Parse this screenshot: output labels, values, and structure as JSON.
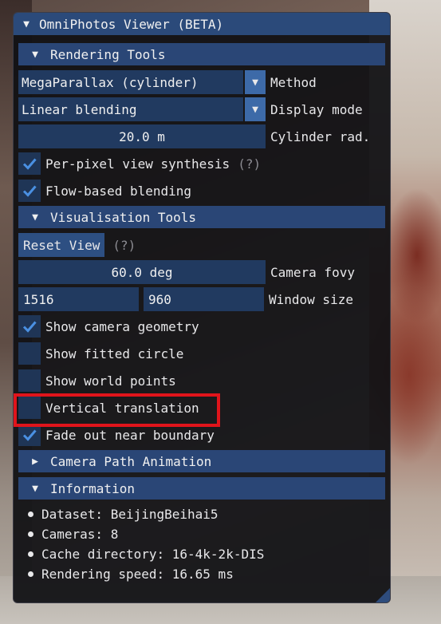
{
  "window": {
    "title": "OmniPhotos Viewer (BETA)"
  },
  "rendering": {
    "header": "Rendering Tools",
    "method": {
      "value": "MegaParallax (cylinder)",
      "label": "Method"
    },
    "display_mode": {
      "value": "Linear blending",
      "label": "Display mode"
    },
    "cylinder_radius": {
      "value": "20.0 m",
      "label": "Cylinder rad."
    },
    "per_pixel": {
      "label": "Per-pixel view synthesis",
      "checked": true,
      "hint": "(?)"
    },
    "flow_blending": {
      "label": "Flow-based blending",
      "checked": true
    }
  },
  "visualisation": {
    "header": "Visualisation Tools",
    "reset_view": "Reset View",
    "reset_hint": "(?)",
    "camera_fovy": {
      "value": "60.0 deg",
      "label": "Camera fovy"
    },
    "window_size": {
      "width": "1516",
      "height": "960",
      "label": "Window size"
    },
    "options": [
      {
        "label": "Show camera geometry",
        "checked": true
      },
      {
        "label": "Show fitted circle",
        "checked": false
      },
      {
        "label": "Show world points",
        "checked": false
      },
      {
        "label": "Vertical translation",
        "checked": false
      },
      {
        "label": "Fade out near boundary",
        "checked": true
      }
    ]
  },
  "camera_path": {
    "header": "Camera Path Animation"
  },
  "information": {
    "header": "Information",
    "items": [
      "Dataset: BeijingBeihai5",
      "Cameras: 8",
      "Cache directory: 16-4k-2k-DIS",
      "Rendering speed: 16.65 ms"
    ]
  },
  "colors": {
    "accent": "#2a4676",
    "check": "#4a90e2",
    "highlight": "#e0141b"
  }
}
